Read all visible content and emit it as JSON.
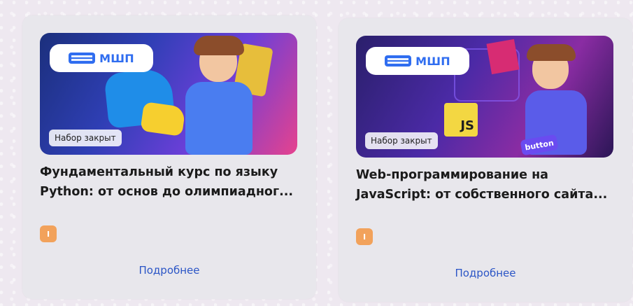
{
  "cards": [
    {
      "brand": "МШП",
      "badge": "Набор закрыт",
      "title": "Фундаментальный курс по языку Python: от основ до олимпиадног...",
      "level": "I",
      "link": "Подробнее"
    },
    {
      "brand": "МШП",
      "badge": "Набор закрыт",
      "title": "Web-программирование на JavaScript: от собственного сайта...",
      "level": "I",
      "link": "Подробнее",
      "illustration_texts": {
        "js": "JS",
        "button": "button"
      }
    }
  ],
  "colors": {
    "brand_blue": "#2f6df0",
    "link_blue": "#2b55c6",
    "level_badge": "#f2a25b",
    "card_bg": "#e8e7ec"
  }
}
